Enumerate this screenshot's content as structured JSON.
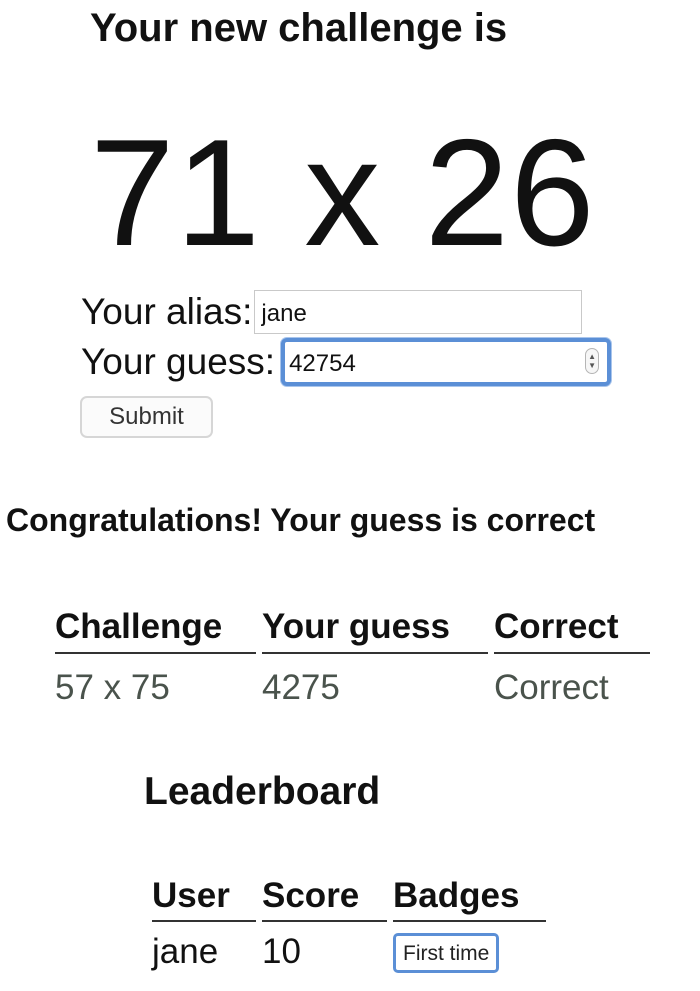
{
  "challenge": {
    "heading": "Your new challenge is",
    "expression": "71 x 26"
  },
  "form": {
    "alias_label": "Your alias:",
    "alias_value": "jane",
    "guess_label": "Your guess:",
    "guess_value": "42754",
    "submit_label": "Submit"
  },
  "result": {
    "message": "Congratulations! Your guess is correct"
  },
  "attempts": {
    "headers": [
      "Challenge",
      "Your guess",
      "Correct"
    ],
    "rows": [
      {
        "challenge": "57 x 75",
        "guess": "4275",
        "correct": "Correct"
      }
    ]
  },
  "leaderboard": {
    "title": "Leaderboard",
    "headers": [
      "User",
      "Score",
      "Badges"
    ],
    "rows": [
      {
        "user": "jane",
        "score": "10",
        "badges": [
          "First time"
        ]
      }
    ]
  },
  "colors": {
    "focus_accent": "#5b8fd6",
    "muted_text": "#4a534c"
  }
}
